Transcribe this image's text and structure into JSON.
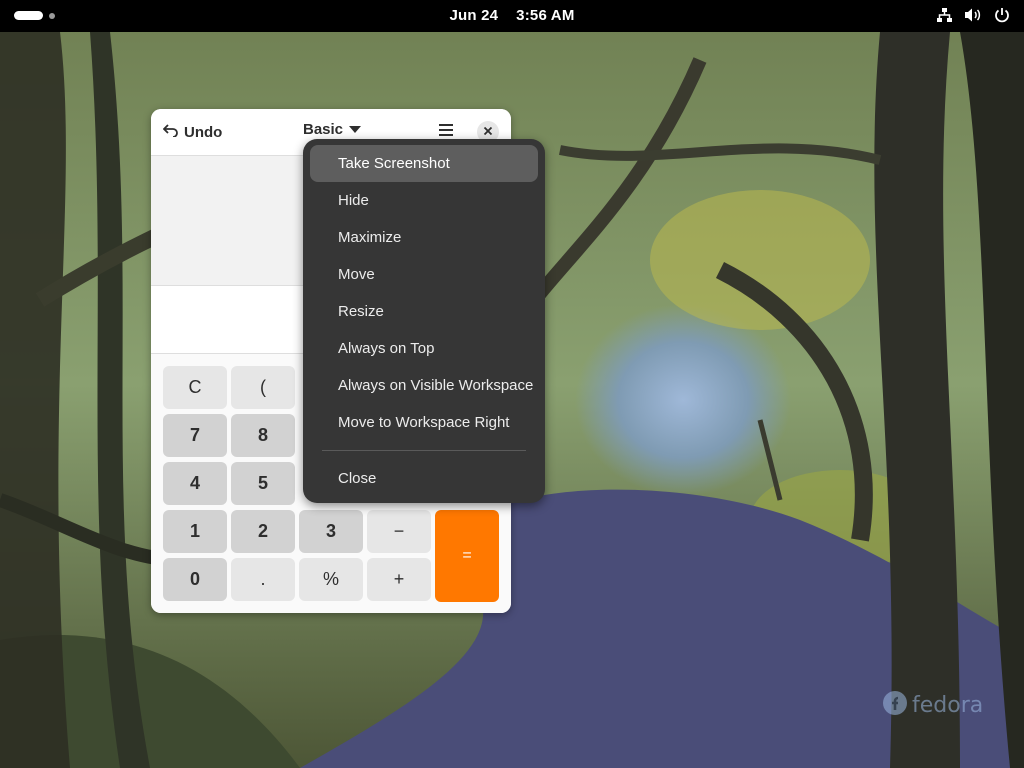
{
  "topbar": {
    "date": "Jun 24",
    "time": "3:56 AM",
    "icons": [
      "network-icon",
      "volume-icon",
      "power-icon"
    ]
  },
  "calculator": {
    "undo_label": "Undo",
    "mode_label": "Basic",
    "keys": {
      "clear": "C",
      "open_paren": "(",
      "seven": "7",
      "eight": "8",
      "four": "4",
      "five": "5",
      "one": "1",
      "two": "2",
      "three": "3",
      "minus": "−",
      "zero": "0",
      "point": ".",
      "percent": "%",
      "plus": "+",
      "equals": "="
    },
    "accent_color": "#ff7800"
  },
  "window_menu": {
    "items": [
      "Take Screenshot",
      "Hide",
      "Maximize",
      "Move",
      "Resize",
      "Always on Top",
      "Always on Visible Workspace",
      "Move to Workspace Right",
      "Close"
    ],
    "highlighted": "Take Screenshot"
  },
  "watermark": {
    "text": "fedora"
  }
}
